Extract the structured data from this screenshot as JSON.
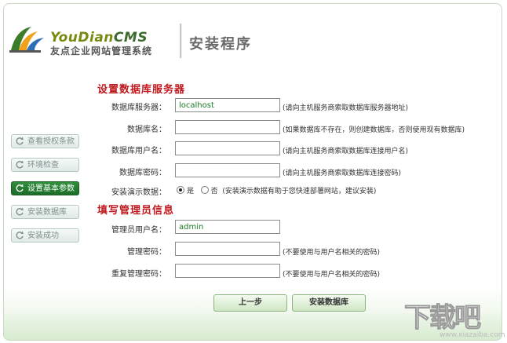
{
  "logo": {
    "brand_you": "YouDian",
    "brand_cms": "CMS",
    "tagline": "友点企业网站管理系统"
  },
  "header": {
    "title": "安装程序"
  },
  "sidebar": {
    "items": [
      {
        "label": "查看授权条款"
      },
      {
        "label": "环境检查"
      },
      {
        "label": "设置基本参数",
        "active": true
      },
      {
        "label": "安装数据库"
      },
      {
        "label": "安装成功"
      }
    ]
  },
  "db_section": {
    "heading": "设置数据库服务器",
    "server": {
      "label": "数据库服务器：",
      "value": "localhost",
      "hint": "(请向主机服务商索取数据库服务器地址)"
    },
    "name": {
      "label": "数据库名：",
      "value": "",
      "hint": "(如果数据库不存在，则创建数据库，否则使用现有数据库)"
    },
    "user": {
      "label": "数据库用户名：",
      "value": "",
      "hint": "(请向主机服务商索取数据库连接用户名)"
    },
    "password": {
      "label": "数据库密码：",
      "value": "",
      "hint": "(请向主机服务商索取数据库连接密码)"
    },
    "demo": {
      "label": "安装演示数据：",
      "yes": "是",
      "no": "否",
      "selected": "是",
      "hint": "(安装演示数据有助于您快速部署网站，建议安装)"
    }
  },
  "admin_section": {
    "heading": "填写管理员信息",
    "username": {
      "label": "管理员用户名：",
      "value": "admin"
    },
    "password": {
      "label": "管理密码：",
      "value": "",
      "hint": "(不要使用与用户名相关的密码)"
    },
    "confirm": {
      "label": "重复管理密码：",
      "value": "",
      "hint": "(不要使用与用户名相关的密码)"
    }
  },
  "buttons": {
    "prev": "上一步",
    "install": "安装数据库"
  },
  "watermark": {
    "text": "下载吧",
    "url": "www.xiazaiba.com"
  },
  "colors": {
    "accent_red": "#c0171d",
    "active_green": "#1b6d27"
  }
}
